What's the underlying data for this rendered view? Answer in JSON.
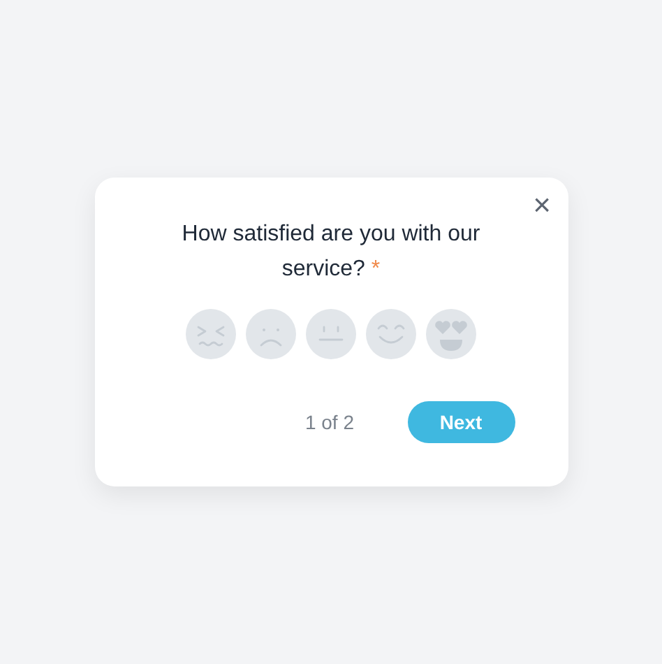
{
  "dialog": {
    "close": "×",
    "question": "How satisfied are you with our service?",
    "required_mark": "*",
    "ratings": [
      {
        "kind": "angry",
        "selected": false
      },
      {
        "kind": "sad",
        "selected": false
      },
      {
        "kind": "neutral",
        "selected": false
      },
      {
        "kind": "happy",
        "selected": false
      },
      {
        "kind": "love",
        "selected": false
      }
    ],
    "pager": "1 of 2",
    "next": "Next"
  }
}
